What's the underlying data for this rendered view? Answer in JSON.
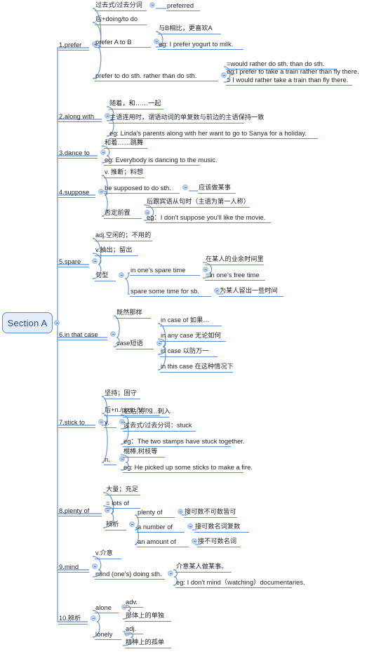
{
  "title": "Section A",
  "colors": {
    "branch": "#5d8fd1",
    "root_fill": "#e4edf9",
    "root_border": "#5b8fd4",
    "root_text": "#2f4f7f",
    "toggle_fill": "#bcd2ec",
    "text": "#262626"
  },
  "icons": {
    "collapse": "collapse-toggle-icon"
  },
  "root": {
    "label": "Section A"
  },
  "branches": [
    {
      "label": "1.prefer",
      "children": [
        {
          "label": "过去式/过去分词",
          "children": [
            {
              "label": "preferred"
            }
          ]
        },
        {
          "label": "后+doing/to do"
        },
        {
          "label": "prefer A to B",
          "children": [
            {
              "label": "与B相比，更喜欢A"
            },
            {
              "label": "eg: I prefer yogurt to milk."
            }
          ]
        },
        {
          "label": "prefer to do sth. rather than do sth.",
          "children": [
            {
              "label": "=would rather do sth. than do sth."
            },
            {
              "label": "eg:I prefer to take a train rather than fly there.",
              "label2": "= I would rather take a train than fly there."
            }
          ]
        }
      ]
    },
    {
      "label": "2.along with",
      "children": [
        {
          "label": "随着，和……一起"
        },
        {
          "label": "主语连用时，谓语动词的单复数与前边的主语保持一致"
        },
        {
          "label": "eg: Linda's parents along with her want to go to Sanya for a holiday."
        }
      ]
    },
    {
      "label": "3.dance to",
      "children": [
        {
          "label": "和着……跳舞"
        },
        {
          "label": "eg: Everybody is dancing to the music."
        }
      ]
    },
    {
      "label": "4.suppose",
      "children": [
        {
          "label": "v. 推断；料想"
        },
        {
          "label": "be supposed to do sth.",
          "children": [
            {
              "label": "应该做某事"
            }
          ]
        },
        {
          "label": "否定前置",
          "children": [
            {
              "label": "后跟宾语从句时（主语为第一人称）"
            },
            {
              "label": "eg：I don't suppose you'll like the movie."
            }
          ]
        }
      ]
    },
    {
      "label": "5.spare",
      "children": [
        {
          "label": "adj.空闲的；不用的"
        },
        {
          "label": "v.抽出；留出"
        },
        {
          "label": "句型",
          "children": [
            {
              "label": "in one's spare time",
              "children": [
                {
                  "label": "在某人的业余时间里"
                },
                {
                  "label": "=in one's free time"
                }
              ]
            },
            {
              "label": "spare some time for sb.",
              "children": [
                {
                  "label": "为某人留出一些时间"
                }
              ]
            }
          ]
        }
      ]
    },
    {
      "label": "6.in that case",
      "children": [
        {
          "label": "既然那样"
        },
        {
          "label": "case短语",
          "children": [
            {
              "label": "in case of 如果…"
            },
            {
              "label": "in any case 无论如何"
            },
            {
              "label": "in case 以防万一"
            },
            {
              "label": "in this case 在这种情况下"
            }
          ]
        }
      ]
    },
    {
      "label": "7.stick to",
      "children": [
        {
          "label": "坚持；固守"
        },
        {
          "label": "后+n./pron./V.ing"
        },
        {
          "label": "v.",
          "children": [
            {
              "label": "粘贴,将……刺入"
            },
            {
              "label": "过去式/过去分词：stuck"
            },
            {
              "label": "eg：The two stamps have stuck together."
            }
          ]
        },
        {
          "label": "n.",
          "children": [
            {
              "label": "棍棒,树枝等"
            },
            {
              "label": "eg: He picked up some sticks to make a fire."
            }
          ]
        }
      ]
    },
    {
      "label": "8.plenty of",
      "children": [
        {
          "label": "大量；充足"
        },
        {
          "label": "= lots of"
        },
        {
          "label": "辨析",
          "children": [
            {
              "label": "plenty of",
              "children": [
                {
                  "label": "接可数不可数皆可"
                }
              ]
            },
            {
              "label": "a number of",
              "children": [
                {
                  "label": "接可数名词复数"
                }
              ]
            },
            {
              "label": "an amount of",
              "children": [
                {
                  "label": "接不可数名词"
                }
              ]
            }
          ]
        }
      ]
    },
    {
      "label": "9.mind",
      "children": [
        {
          "label": "v.介意"
        },
        {
          "label": "mind (one's) doing sth.",
          "children": [
            {
              "label": "介意某人做某事。"
            },
            {
              "label": "eg: I don't mind（watching）documentaries."
            }
          ]
        }
      ]
    },
    {
      "label": "10.辨析",
      "children": [
        {
          "label": "alone",
          "children": [
            {
              "label": "adv."
            },
            {
              "label": "形体上的单独"
            }
          ]
        },
        {
          "label": "lonely",
          "children": [
            {
              "label": "adj."
            },
            {
              "label": "精神上的孤单"
            }
          ]
        }
      ]
    }
  ]
}
